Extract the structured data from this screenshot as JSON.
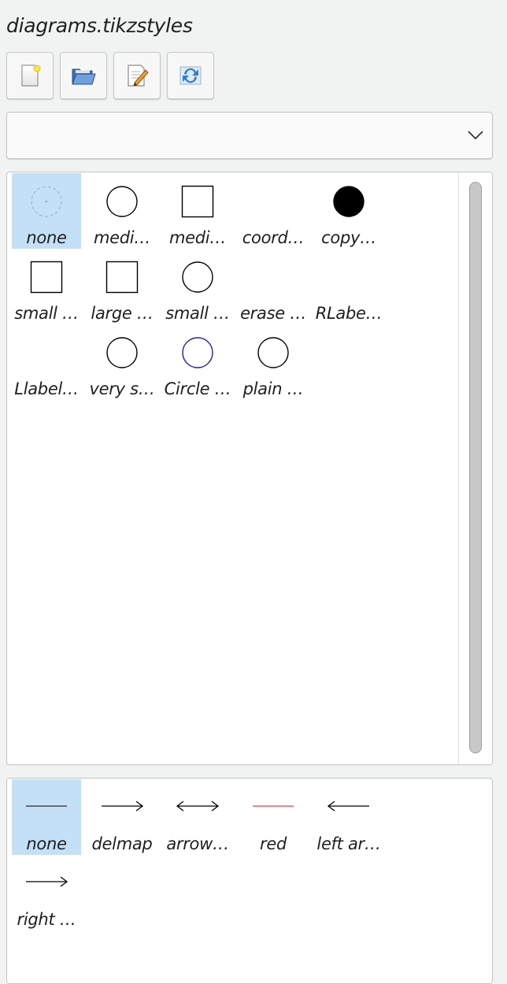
{
  "panel": {
    "title": "diagrams.tikzstyles"
  },
  "toolbar": {
    "buttons": [
      {
        "name": "new-style-button",
        "icon": "new-file-icon"
      },
      {
        "name": "open-style-button",
        "icon": "folder-open-icon"
      },
      {
        "name": "edit-style-button",
        "icon": "edit-icon"
      },
      {
        "name": "refresh-style-button",
        "icon": "refresh-icon"
      }
    ]
  },
  "category_select": {
    "value": ""
  },
  "node_styles": [
    {
      "label": "none",
      "shape": "none",
      "selected": true
    },
    {
      "label": "medi…",
      "shape": "circle",
      "stroke": "#000000",
      "fill": "none"
    },
    {
      "label": "medi…",
      "shape": "square",
      "stroke": "#000000",
      "fill": "none"
    },
    {
      "label": "coord…",
      "shape": "blank"
    },
    {
      "label": "copy…",
      "shape": "circle",
      "stroke": "#000000",
      "fill": "#000000"
    },
    {
      "label": "small …",
      "shape": "square",
      "stroke": "#000000",
      "fill": "none"
    },
    {
      "label": "large …",
      "shape": "square",
      "stroke": "#000000",
      "fill": "none"
    },
    {
      "label": "small …",
      "shape": "circle",
      "stroke": "#000000",
      "fill": "none"
    },
    {
      "label": "erase …",
      "shape": "blank"
    },
    {
      "label": "RLabe…",
      "shape": "blank"
    },
    {
      "label": "Llabel…",
      "shape": "blank"
    },
    {
      "label": "very s…",
      "shape": "circle",
      "stroke": "#000000",
      "fill": "none"
    },
    {
      "label": "Circle …",
      "shape": "circle",
      "stroke": "#1a1adb",
      "fill": "none"
    },
    {
      "label": "plain …",
      "shape": "circle",
      "stroke": "#000000",
      "fill": "none"
    }
  ],
  "edge_styles": [
    {
      "label": "none",
      "line": "plain",
      "color": "#2a2a2a",
      "selected": true
    },
    {
      "label": "delmap",
      "line": "right-arrow",
      "color": "#000000"
    },
    {
      "label": "arrow…",
      "line": "double-arrow",
      "color": "#000000"
    },
    {
      "label": "red",
      "line": "plain",
      "color": "#e04545"
    },
    {
      "label": "left ar…",
      "line": "left-arrow",
      "color": "#000000"
    },
    {
      "label": "right …",
      "line": "right-arrow",
      "color": "#000000"
    }
  ],
  "colors": {
    "selection": "#c4e0f7",
    "none_dash": "#9fb1d6"
  }
}
